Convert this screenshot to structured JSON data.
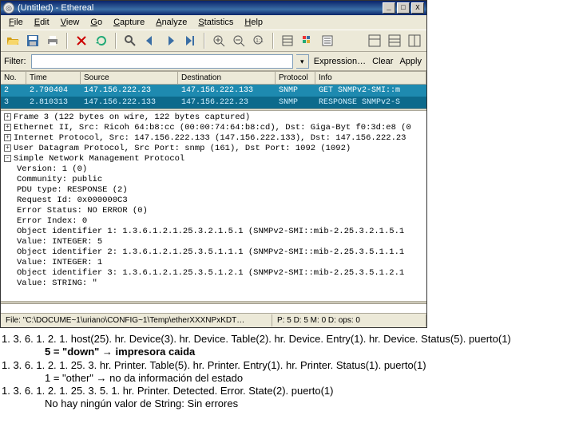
{
  "titlebar": {
    "title": "(Untitled) - Ethereal",
    "min_glyph": "_",
    "max_glyph": "□",
    "close_glyph": "X"
  },
  "menubar": {
    "items": [
      {
        "key": "file",
        "label": "File",
        "accel": "F"
      },
      {
        "key": "edit",
        "label": "Edit",
        "accel": "E"
      },
      {
        "key": "view",
        "label": "View",
        "accel": "V"
      },
      {
        "key": "go",
        "label": "Go",
        "accel": "G"
      },
      {
        "key": "capture",
        "label": "Capture",
        "accel": "C"
      },
      {
        "key": "analyze",
        "label": "Analyze",
        "accel": "A"
      },
      {
        "key": "statistics",
        "label": "Statistics",
        "accel": "S"
      },
      {
        "key": "help",
        "label": "Help",
        "accel": "H"
      }
    ]
  },
  "filterbar": {
    "label": "Filter:",
    "placeholder": "",
    "value": "",
    "dropdown_glyph": "▾",
    "expression": "Expression…",
    "clear": "Clear",
    "apply": "Apply"
  },
  "packet_list": {
    "headers": {
      "no": "No.",
      "time": "Time",
      "source": "Source",
      "destination": "Destination",
      "protocol": "Protocol",
      "info": "Info"
    },
    "rows": [
      {
        "no": "2",
        "time": "2.790404",
        "source": "147.156.222.23",
        "destination": "147.156.222.133",
        "protocol": "SNMP",
        "info": "GET SNMPv2-SMI::m"
      },
      {
        "no": "3",
        "time": "2.810313",
        "source": "147.156.222.133",
        "destination": "147.156.222.23",
        "protocol": "SNMP",
        "info": "RESPONSE SNMPv2-S"
      }
    ]
  },
  "tree": {
    "lines": [
      {
        "box": "+",
        "indent": 0,
        "text": "Frame 3 (122 bytes on wire, 122 bytes captured)"
      },
      {
        "box": "+",
        "indent": 0,
        "text": "Ethernet II, Src: Ricoh 64:b8:cc (00:00:74:64:b8:cd), Dst: Giga-Byt f0:3d:e8 (0"
      },
      {
        "box": "+",
        "indent": 0,
        "text": "Internet Protocol, Src: 147.156.222.133 (147.156.222.133), Dst: 147.156.222.23"
      },
      {
        "box": "+",
        "indent": 0,
        "text": "User Datagram Protocol, Src Port: snmp (161), Dst Port: 1092 (1092)"
      },
      {
        "box": "-",
        "indent": 0,
        "text": "Simple Network Management Protocol"
      },
      {
        "box": "",
        "indent": 1,
        "text": "Version: 1 (0)"
      },
      {
        "box": "",
        "indent": 1,
        "text": "Community: public"
      },
      {
        "box": "",
        "indent": 1,
        "text": "PDU type: RESPONSE (2)"
      },
      {
        "box": "",
        "indent": 1,
        "text": "Request Id: 0x000000C3"
      },
      {
        "box": "",
        "indent": 1,
        "text": "Error Status: NO ERROR (0)"
      },
      {
        "box": "",
        "indent": 1,
        "text": "Error Index: 0"
      },
      {
        "box": "",
        "indent": 1,
        "text": "Object identifier 1: 1.3.6.1.2.1.25.3.2.1.5.1 (SNMPv2-SMI::mib-2.25.3.2.1.5.1"
      },
      {
        "box": "",
        "indent": 1,
        "text": "Value: INTEGER: 5"
      },
      {
        "box": "",
        "indent": 1,
        "text": "Object identifier 2: 1.3.6.1.2.1.25.3.5.1.1.1 (SNMPv2-SMI::mib-2.25.3.5.1.1.1"
      },
      {
        "box": "",
        "indent": 1,
        "text": "Value: INTEGER: 1"
      },
      {
        "box": "",
        "indent": 1,
        "text": "Object identifier 3: 1.3.6.1.2.1.25.3.5.1.2.1 (SNMPv2-SMI::mib-2.25.3.5.1.2.1"
      },
      {
        "box": "",
        "indent": 1,
        "text": "Value: STRING: \""
      }
    ]
  },
  "statusbar": {
    "file_path": "File: \"C:\\DOCUME~1\\uriano\\CONFIG~1\\Temp\\etherXXXNPxKDT…",
    "packets": "P: 5 D: 5 M: 0 D: ops: 0"
  },
  "notes": {
    "lines": [
      {
        "kind": "plain",
        "text": "1. 3. 6. 1. 2. 1. host(25). hr. Device(3). hr. Device. Table(2). hr. Device. Entry(1). hr. Device. Status(5). puerto(1)"
      },
      {
        "kind": "indent-bold",
        "text": "5 = \"down\" → impresora caida"
      },
      {
        "kind": "plain",
        "text": "1. 3. 6. 1. 2. 1. 25. 3. hr. Printer. Table(5). hr. Printer. Entry(1). hr. Printer. Status(1). puerto(1)"
      },
      {
        "kind": "indent",
        "text": "1 = \"other\" → no da información del estado"
      },
      {
        "kind": "plain",
        "text": "1. 3. 6. 1. 2. 1. 25. 3. 5. 1. hr. Printer. Detected. Error. State(2). puerto(1)"
      },
      {
        "kind": "indent",
        "text": "No hay ningún valor de String: Sin errores"
      }
    ]
  }
}
